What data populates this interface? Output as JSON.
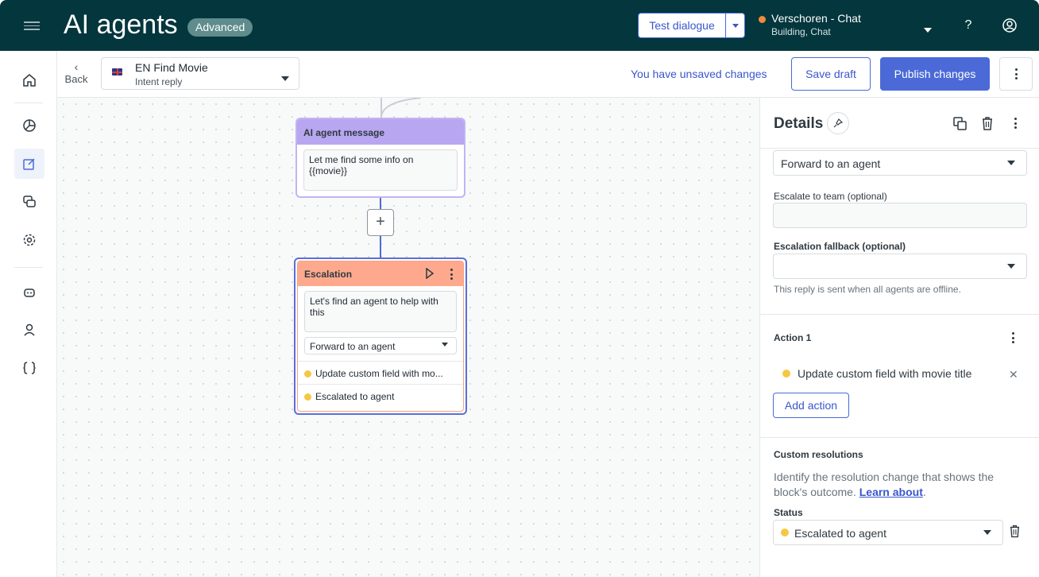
{
  "topbar": {
    "app_title": "AI agents",
    "badge": "Advanced",
    "test_dialogue": "Test dialogue",
    "workspace_name": "Verschoren - Chat",
    "workspace_sub": "Building, Chat",
    "help": "?",
    "icons": [
      "menu-icon",
      "chevron-down-icon",
      "help-icon",
      "user-icon"
    ]
  },
  "leftnav": {
    "items": [
      "home",
      "analytics",
      "edit",
      "conversations",
      "settings",
      "bot",
      "user",
      "code"
    ]
  },
  "subheader": {
    "back": "Back",
    "intent_name": "EN Find Movie",
    "intent_type": "Intent reply",
    "unsaved": "You have unsaved changes",
    "save_draft": "Save draft",
    "publish": "Publish changes"
  },
  "canvas": {
    "msg_card": {
      "title": "AI agent message",
      "text": "Let me find some info on {{movie}}"
    },
    "add_step": "+",
    "escalation_card": {
      "title": "Escalation",
      "text": "Let's find an agent to help with this",
      "select": "Forward to an agent",
      "row1": "Update custom field with mo...",
      "row2": "Escalated to agent"
    }
  },
  "panel": {
    "title": "Details",
    "escalation_type": "Forward to an agent",
    "escalate_team_label": "Escalate to team (optional)",
    "fallback_label": "Escalation fallback (optional)",
    "fallback_hint": "This reply is sent when all agents are offline.",
    "action_title": "Action 1",
    "action_item": "Update custom field with movie title",
    "add_action": "Add action",
    "custom_res_title": "Custom resolutions",
    "custom_res_desc": "Identify the resolution change that shows the block's outcome.",
    "learn_about": "Learn about",
    "status_label": "Status",
    "status_value": "Escalated to agent"
  },
  "colors": {
    "topbar": "#03363d",
    "accent": "#4b6ad7",
    "msg_header": "#b9a6f1",
    "escalation_header": "#fea98d",
    "status_dot": "#f5c842",
    "workspace_dot": "#f08a3c"
  }
}
